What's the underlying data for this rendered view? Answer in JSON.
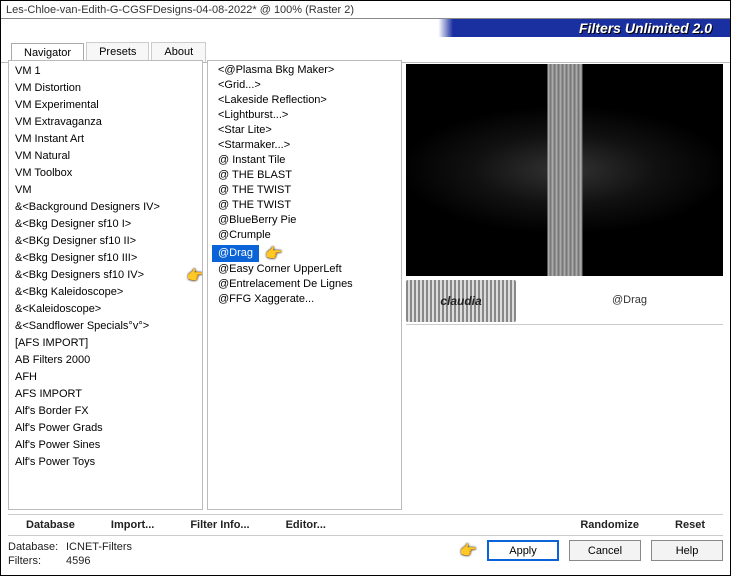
{
  "title": "Les-Chloe-van-Edith-G-CGSFDesigns-04-08-2022* @ 100% (Raster 2)",
  "brand": "Filters Unlimited 2.0",
  "tabs": [
    "Navigator",
    "Presets",
    "About"
  ],
  "active_tab": 0,
  "categories": [
    "VM 1",
    "VM Distortion",
    "VM Experimental",
    "VM Extravaganza",
    "VM Instant Art",
    "VM Natural",
    "VM Toolbox",
    "VM",
    "&<Background Designers IV>",
    "&<Bkg Designer sf10 I>",
    "&<BKg Designer sf10 II>",
    "&<Bkg Designer sf10 III>",
    "&<Bkg Designers sf10 IV>",
    "&<Bkg Kaleidoscope>",
    "&<Kaleidoscope>",
    "&<Sandflower Specials°v°>",
    "[AFS IMPORT]",
    "AB Filters 2000",
    "AFH",
    "AFS IMPORT",
    "Alf's Border FX",
    "Alf's Power Grads",
    "Alf's Power Sines",
    "Alf's Power Toys"
  ],
  "category_pointer_index": 12,
  "filters": [
    "<@Plasma Bkg Maker>",
    "<Grid...>",
    "<Lakeside Reflection>",
    "<Lightburst...>",
    "<Star Lite>",
    "<Starmaker...>",
    "@ Instant Tile",
    "@ THE BLAST",
    "@ THE TWIST",
    "@ THE TWIST",
    "@BlueBerry Pie",
    "@Crumple",
    "@Drag",
    "@Easy Corner UpperLeft",
    "@Entrelacement De Lignes",
    "@FFG Xaggerate..."
  ],
  "filter_selected_index": 12,
  "preview_label": "@Drag",
  "stamp_label": "claudia",
  "row1": {
    "database": "Database",
    "import": "Import...",
    "filterinfo": "Filter Info...",
    "editor": "Editor...",
    "randomize": "Randomize",
    "reset": "Reset"
  },
  "footer": {
    "db_k": "Database:",
    "db_v": "ICNET-Filters",
    "fl_k": "Filters:",
    "fl_v": "4596"
  },
  "buttons": {
    "apply": "Apply",
    "cancel": "Cancel",
    "help": "Help"
  }
}
